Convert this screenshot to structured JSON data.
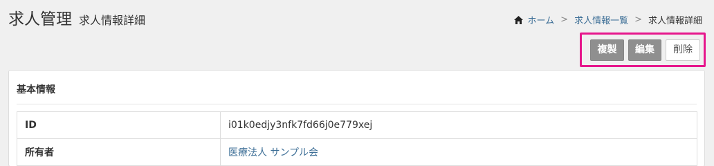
{
  "header": {
    "title": "求人管理",
    "subtitle": "求人情報詳細"
  },
  "breadcrumb": {
    "icon": "home-icon",
    "home": "ホーム",
    "separator": ">",
    "list": "求人情報一覧",
    "current": "求人情報詳細"
  },
  "actions": {
    "duplicate": "複製",
    "edit": "編集",
    "delete": "削除",
    "highlight_color": "#e6168c"
  },
  "panel": {
    "heading": "基本情報",
    "rows": [
      {
        "label": "ID",
        "value": "i01k0edjy3nfk7fd66j0e779xej"
      },
      {
        "label": "所有者",
        "value": "医療法人 サンプル会"
      }
    ]
  }
}
